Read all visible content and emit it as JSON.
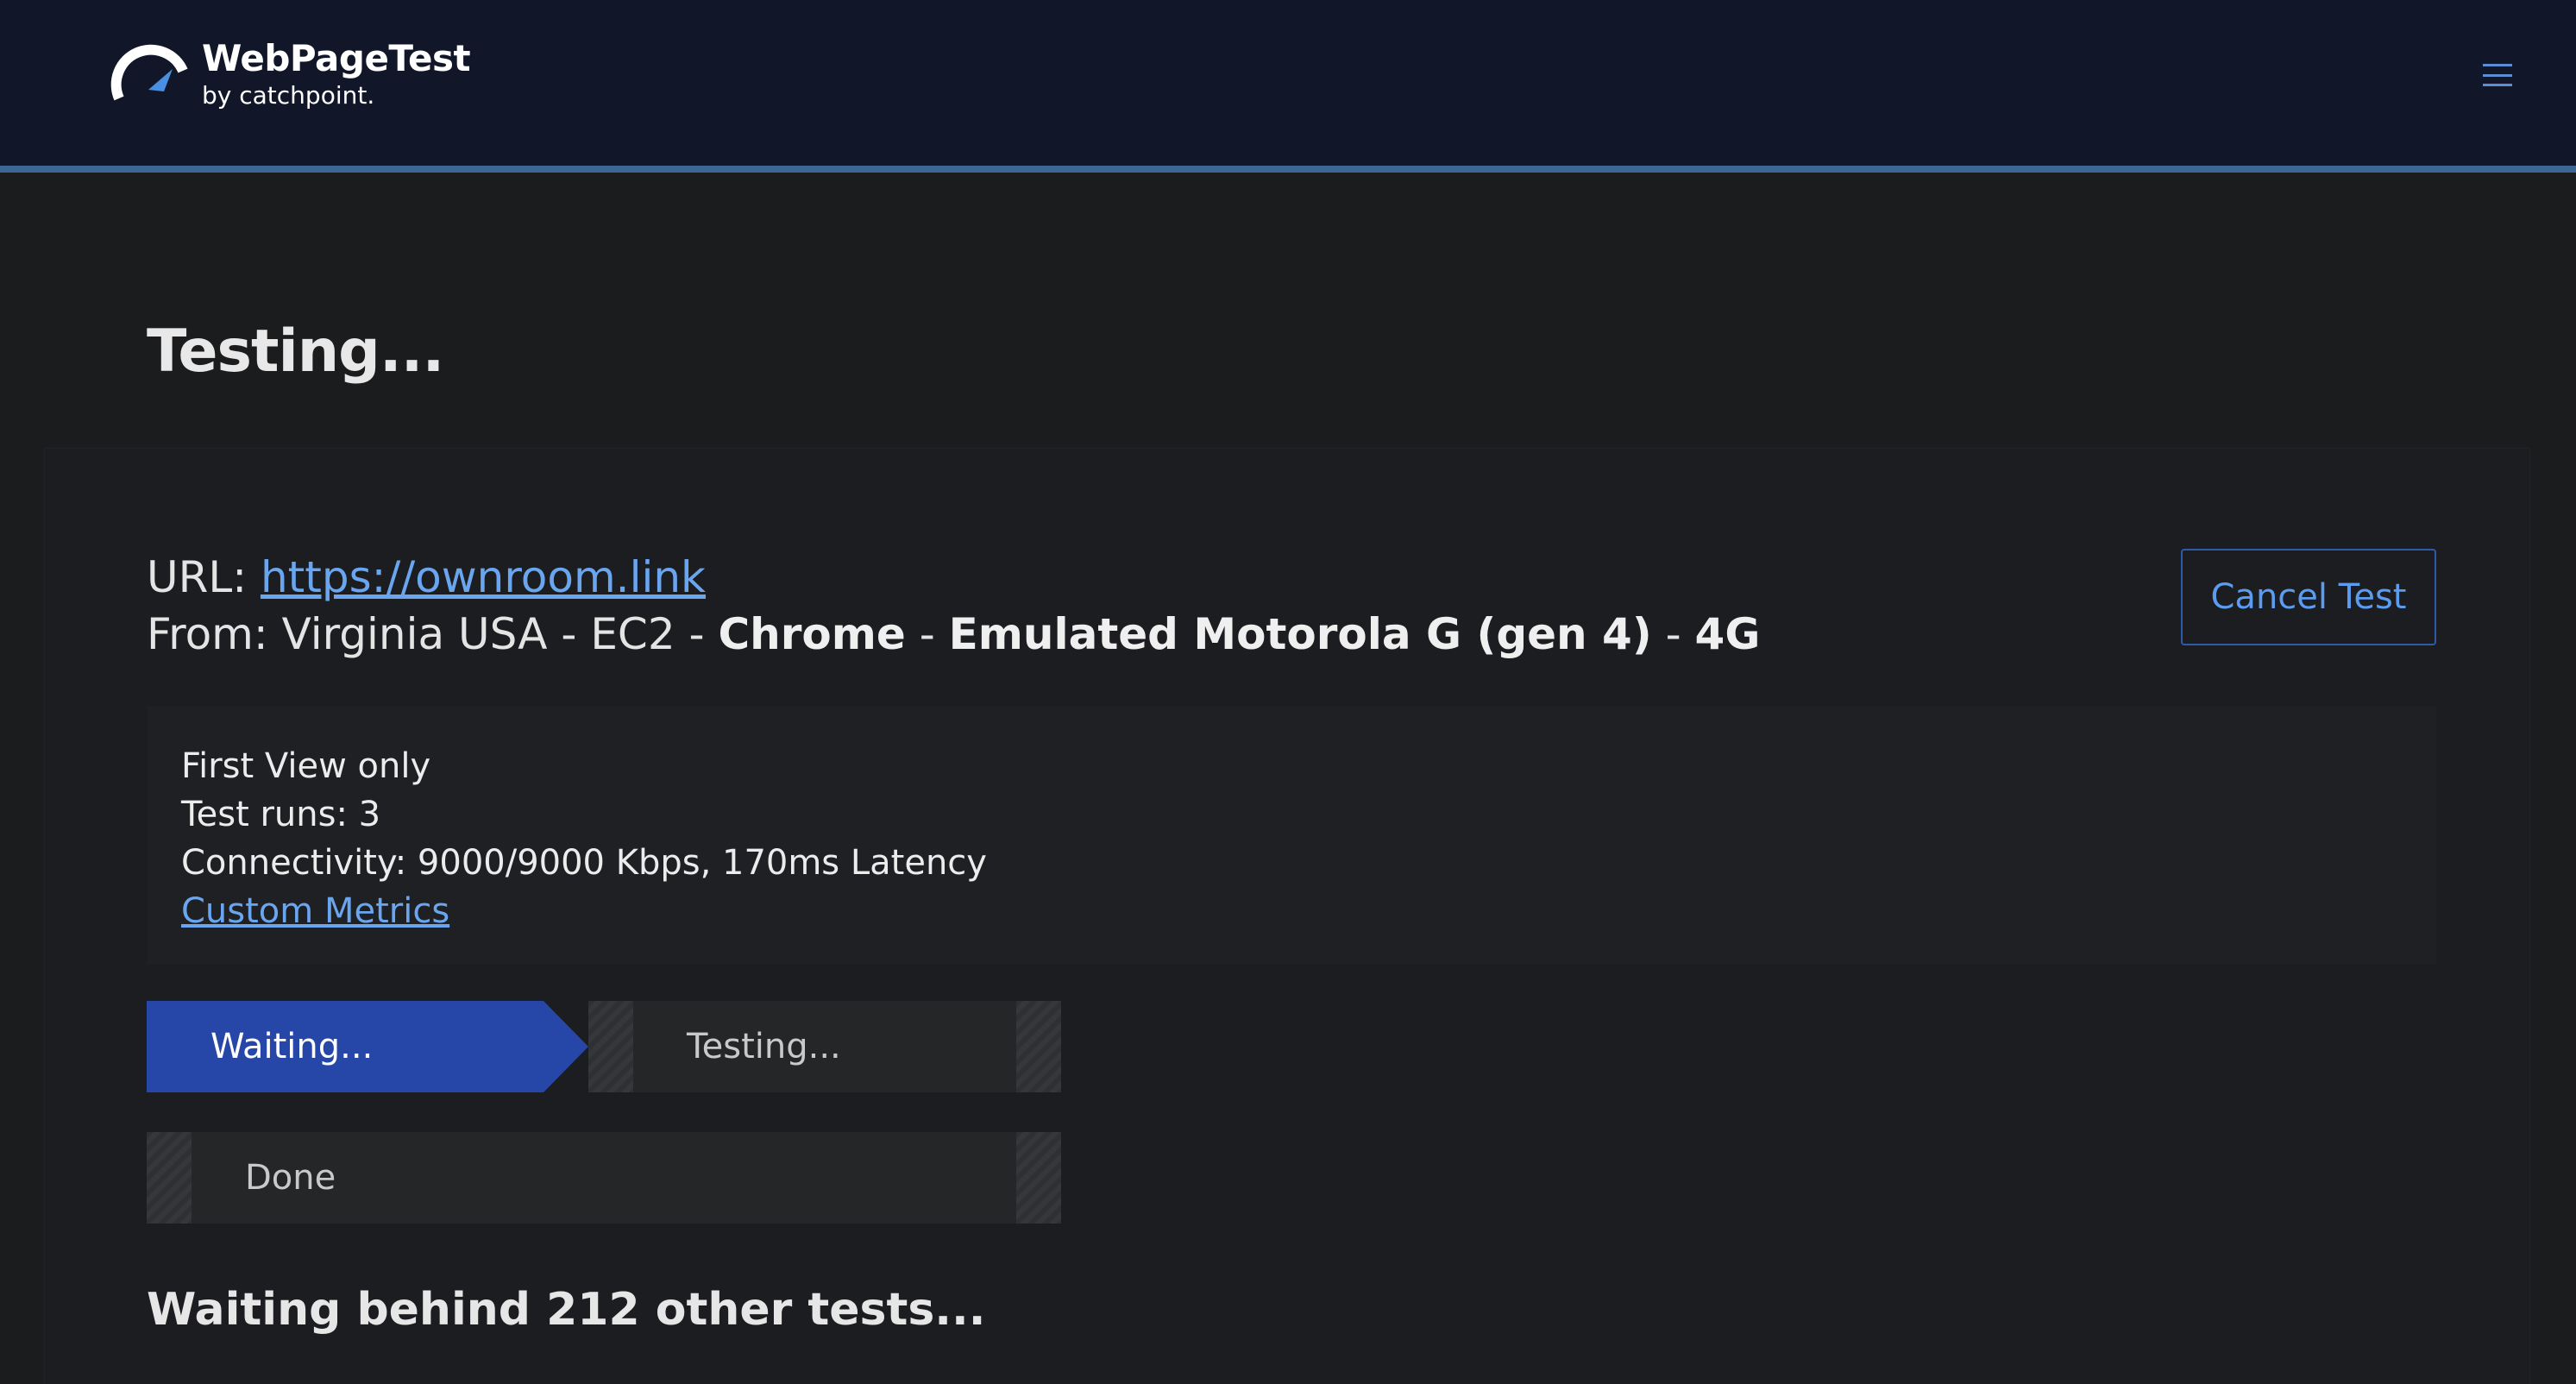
{
  "header": {
    "logo_title": "WebPageTest",
    "logo_subtitle": "by catchpoint.",
    "logo_icon": "gauge-logo-icon",
    "menu_icon": "hamburger-menu-icon"
  },
  "page": {
    "title": "Testing..."
  },
  "test": {
    "url_label": "URL: ",
    "url": "https://ownroom.link",
    "from_label": "From: ",
    "location": "Virginia USA - EC2 - ",
    "browser": "Chrome",
    "sep1": " - ",
    "device": "Emulated Motorola G (gen 4)",
    "sep2": " - ",
    "connection": "4G",
    "cancel_label": "Cancel Test"
  },
  "details": {
    "view": "First View only",
    "runs": "Test runs: 3",
    "connectivity": "Connectivity: 9000/9000 Kbps, 170ms Latency",
    "custom_metrics": "Custom Metrics"
  },
  "steps": [
    {
      "label": "Waiting...",
      "state": "active"
    },
    {
      "label": "Testing...",
      "state": "pending"
    },
    {
      "label": "Done",
      "state": "pending"
    }
  ],
  "status": {
    "message": "Waiting behind 212 other tests..."
  },
  "colors": {
    "header_bg": "#111729",
    "accent": "#3c6795",
    "active_step": "#2747a8",
    "link": "#6aa6f0"
  }
}
